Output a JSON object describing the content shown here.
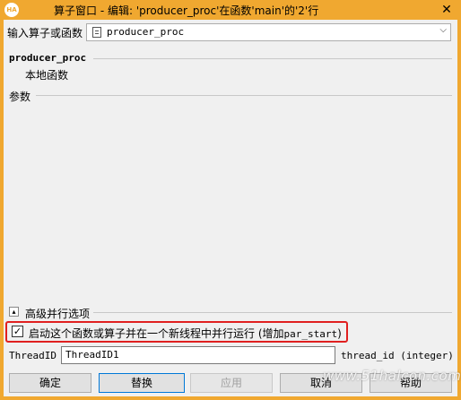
{
  "window": {
    "title": "算子窗口 - 编辑: 'producer_proc'在函数'main'的'2'行",
    "logo_text": "HA",
    "close_glyph": "✕"
  },
  "operator": {
    "label": "输入算子或函数",
    "value": "producer_proc",
    "icon": "function-icon",
    "chevron": "⌵"
  },
  "header": {
    "name": "producer_proc",
    "type": "本地函数"
  },
  "parameters": {
    "label": "参数"
  },
  "advanced": {
    "toggle_glyph": "▴",
    "label": "高级并行选项",
    "parallel_checkbox": {
      "checked": true,
      "check_glyph": "✓",
      "label_prefix": "启动这个函数或算子并在一个新线程中并行运行 (增加",
      "label_code": "par_start",
      "label_suffix": ")"
    },
    "thread_id": {
      "label": "ThreadID",
      "value": "ThreadID1",
      "type": "thread_id (integer)"
    }
  },
  "buttons": {
    "ok": "确定",
    "replace": "替换",
    "apply": "应用",
    "cancel": "取消",
    "help": "帮助"
  },
  "watermark": "www.51halcon.com",
  "colors": {
    "frame": "#f0a830",
    "highlight": "#e02020"
  }
}
